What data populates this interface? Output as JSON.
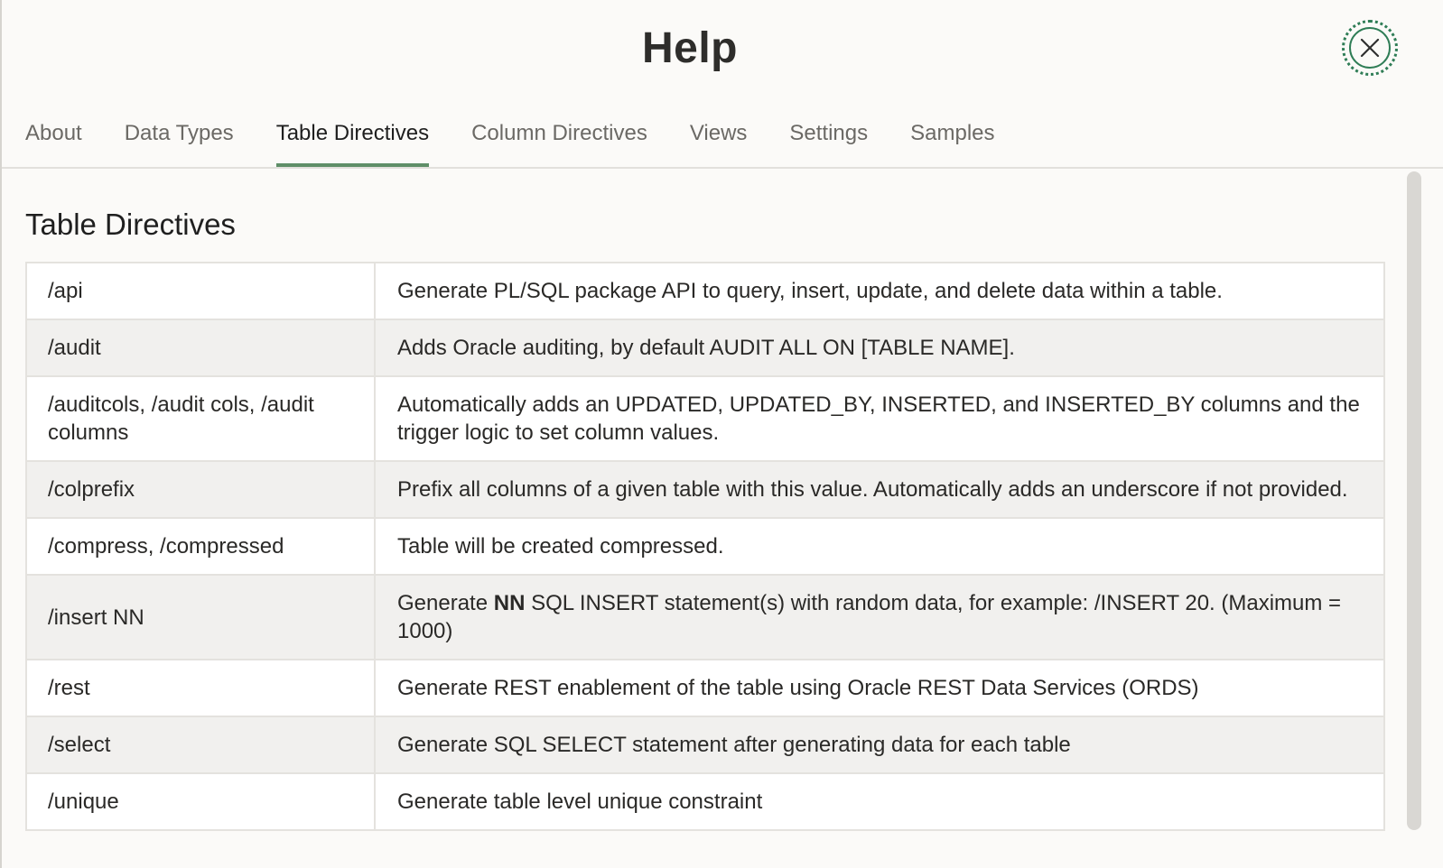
{
  "dialog": {
    "title": "Help",
    "close_icon": "close-icon",
    "accent_color": "#2f7d56"
  },
  "tabs": [
    {
      "label": "About",
      "active": false
    },
    {
      "label": "Data Types",
      "active": false
    },
    {
      "label": "Table Directives",
      "active": true
    },
    {
      "label": "Column Directives",
      "active": false
    },
    {
      "label": "Views",
      "active": false
    },
    {
      "label": "Settings",
      "active": false
    },
    {
      "label": "Samples",
      "active": false
    }
  ],
  "section": {
    "title": "Table Directives"
  },
  "directives": [
    {
      "name": "/api",
      "description": "Generate PL/SQL package API to query, insert, update, and delete data within a table."
    },
    {
      "name": "/audit",
      "description": "Adds Oracle auditing, by default AUDIT ALL ON [TABLE NAME]."
    },
    {
      "name": "/auditcols, /audit cols, /audit columns",
      "description": "Automatically adds an UPDATED, UPDATED_BY, INSERTED, and INSERTED_BY columns and the trigger logic to set column values."
    },
    {
      "name": "/colprefix",
      "description": "Prefix all columns of a given table with this value. Automatically adds an underscore if not provided."
    },
    {
      "name": "/compress, /compressed",
      "description": "Table will be created compressed."
    },
    {
      "name": "/insert NN",
      "description_prefix": "Generate ",
      "description_bold": "NN",
      "description_suffix": " SQL INSERT statement(s) with random data, for example: /INSERT 20. (Maximum = 1000)"
    },
    {
      "name": "/rest",
      "description": "Generate REST enablement of the table using Oracle REST Data Services (ORDS)"
    },
    {
      "name": "/select",
      "description": "Generate SQL SELECT statement after generating data for each table"
    },
    {
      "name": "/unique",
      "description": "Generate table level unique constraint"
    }
  ]
}
